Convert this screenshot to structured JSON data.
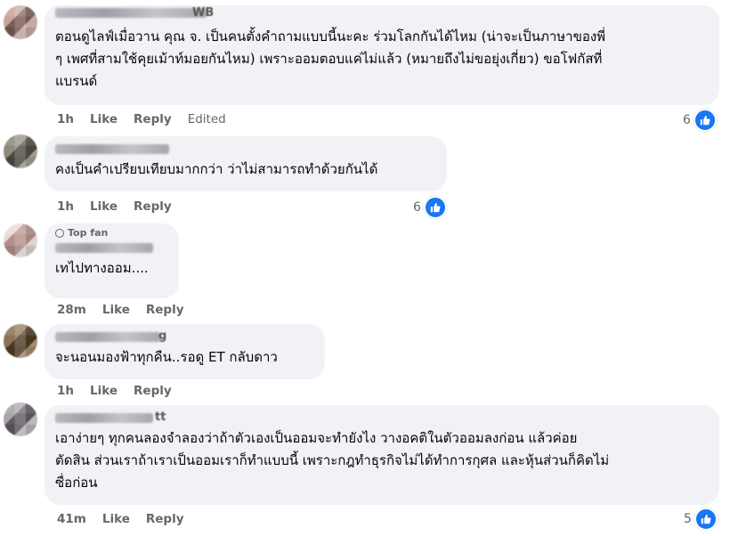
{
  "comments": [
    {
      "author_visible_tail": "WB",
      "text": "ตอนดูไลฟ์เมื่อวาน คุณ จ. เป็นคนตั้งคำถามแบบนี้นะคะ ร่วมโลกกันได้ไหม (น่าจะเป็นภาษาของพี่\nๆ เพศที่สามใช้คุยเม้าท์มอยกันไหม) เพราะออมตอบแค่ไม่แล้ว (หมายถึงไม่ขอยุ่งเกี่ยว) ขอโฟกัสที่\nแบรนด์",
      "time": "1h",
      "like": "Like",
      "reply": "Reply",
      "edited": "Edited",
      "reactions": "6"
    },
    {
      "text": "คงเป็นคำเปรียบเทียบมากกว่า ว่าไม่สามารถทำด้วยกันได้",
      "time": "1h",
      "like": "Like",
      "reply": "Reply",
      "reactions": "6"
    },
    {
      "badge": "Top fan",
      "text": "เทไปทางออม....",
      "time": "28m",
      "like": "Like",
      "reply": "Reply"
    },
    {
      "author_visible_tail": "g",
      "text": "จะนอนมองฟ้าทุกคืน..รอดู ET กลับดาว",
      "time": "1h",
      "like": "Like",
      "reply": "Reply"
    },
    {
      "author_visible_tail": "tt",
      "text": "เอาง่ายๆ ทุกคนลองจำลองว่าถ้าตัวเองเป็นออมจะทำยังไง วางอคติในตัวออมลงก่อน แล้วค่อย\nตัดสิน ส่วนเราถ้าเราเป็นออมเราก็ทำแบบนี้ เพราะกฎทำธุรกิจไม่ได้ทำการกุศล และหุ้นส่วนก็คิดไม่\nซื่อก่อน",
      "time": "41m",
      "like": "Like",
      "reply": "Reply",
      "reactions": "5"
    }
  ],
  "colors": {
    "bubble": "#f0f2f5",
    "meta_text": "#65676b",
    "like_blue": "#1877f2"
  },
  "icons": {
    "reaction": "like-thumbs-up-icon",
    "badge": "top-fan-badge-icon"
  }
}
